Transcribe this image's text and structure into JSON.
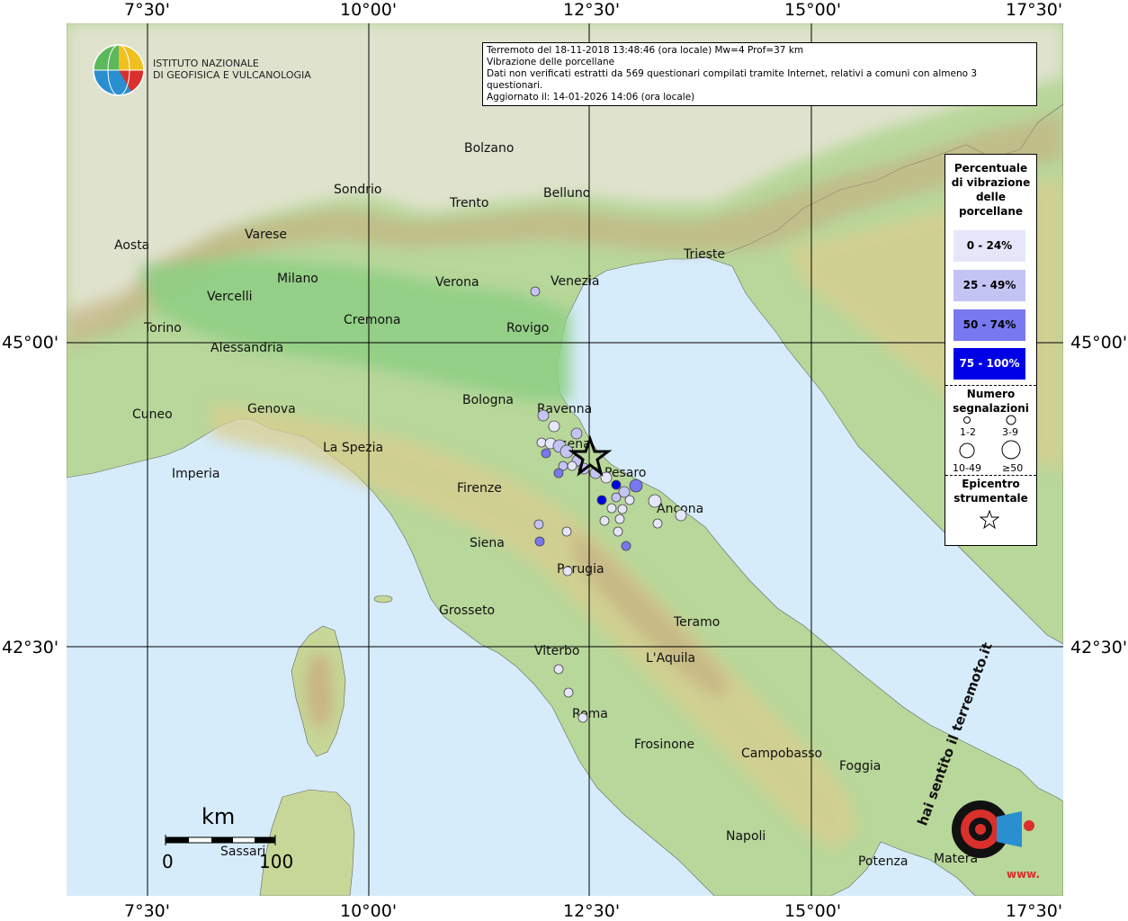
{
  "info": {
    "line1": "Terremoto del 18-11-2018 13:48:46 (ora locale) Mw=4 Prof=37 km",
    "line2": "Vibrazione delle porcellane",
    "line3": "Dati non verificati estratti da 569 questionari compilati tramite Internet, relativi a comuni con almeno 3 questionari.",
    "line4": "Aggiornato il: 14-01-2026 14:06 (ora locale)"
  },
  "institute": {
    "line1": "ISTITUTO NAZIONALE",
    "line2": "DI GEOFISICA E VULCANOLOGIA"
  },
  "axes": {
    "lon_labels": [
      "7°30'",
      "10°00'",
      "12°30'",
      "15°00'",
      "17°30'"
    ],
    "lat_labels": [
      "45°00'",
      "42°30'"
    ]
  },
  "legend": {
    "title": "Percentuale di vibrazione delle porcellane",
    "classes": [
      {
        "label": "0 - 24%",
        "color": "#e6e6fa"
      },
      {
        "label": "25 - 49%",
        "color": "#c4c4f4"
      },
      {
        "label": "50 - 74%",
        "color": "#7878f0"
      },
      {
        "label": "75 - 100%",
        "color": "#0000e6"
      }
    ],
    "count_title": "Numero segnalazioni",
    "counts": [
      "1-2",
      "3-9",
      "10-49",
      "≥50"
    ],
    "epicenter_title": "Epicentro strumentale"
  },
  "scale": {
    "unit": "km",
    "min": "0",
    "max": "100"
  },
  "cities": [
    "Bolzano",
    "Sondrio",
    "Trento",
    "Belluno",
    "Aosta",
    "Varese",
    "Verona",
    "Venezia",
    "Trieste",
    "Milano",
    "Vercelli",
    "Cremona",
    "Rovigo",
    "Torino",
    "Alessandria",
    "Bologna",
    "Ravenna",
    "Cuneo",
    "Genova",
    "Cesena",
    "La Spezia",
    "Pesaro",
    "Imperia",
    "Firenze",
    "Ancona",
    "Siena",
    "Perugia",
    "Grosseto",
    "Teramo",
    "Viterbo",
    "L'Aquila",
    "Roma",
    "Frosinone",
    "Campobasso",
    "Foggia",
    "Napoli",
    "Sassari",
    "Potenza",
    "Matera"
  ],
  "badge": {
    "text": "hai sentito il terremoto.it",
    "sub": "www."
  },
  "colors": {
    "sea": "#d6ecfa",
    "lowland": "#9fd28e",
    "hills": "#d9cd8f",
    "mountains": "#c9a77a",
    "high_alps": "#ece6de"
  }
}
